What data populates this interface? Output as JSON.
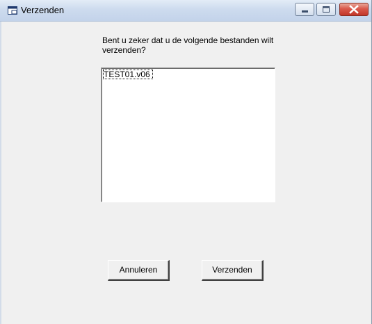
{
  "window": {
    "title": "Verzenden",
    "controls": [
      "minimize-icon",
      "maximize-icon",
      "close-icon"
    ]
  },
  "dialog": {
    "message": "Bent u zeker dat u de volgende bestanden wilt verzenden?",
    "files": [
      "TEST01.v06"
    ]
  },
  "buttons": {
    "cancel_label": "Annuleren",
    "send_label": "Verzenden"
  },
  "colors": {
    "close_button": "#c2362a",
    "titlebar": "#cddbee"
  }
}
